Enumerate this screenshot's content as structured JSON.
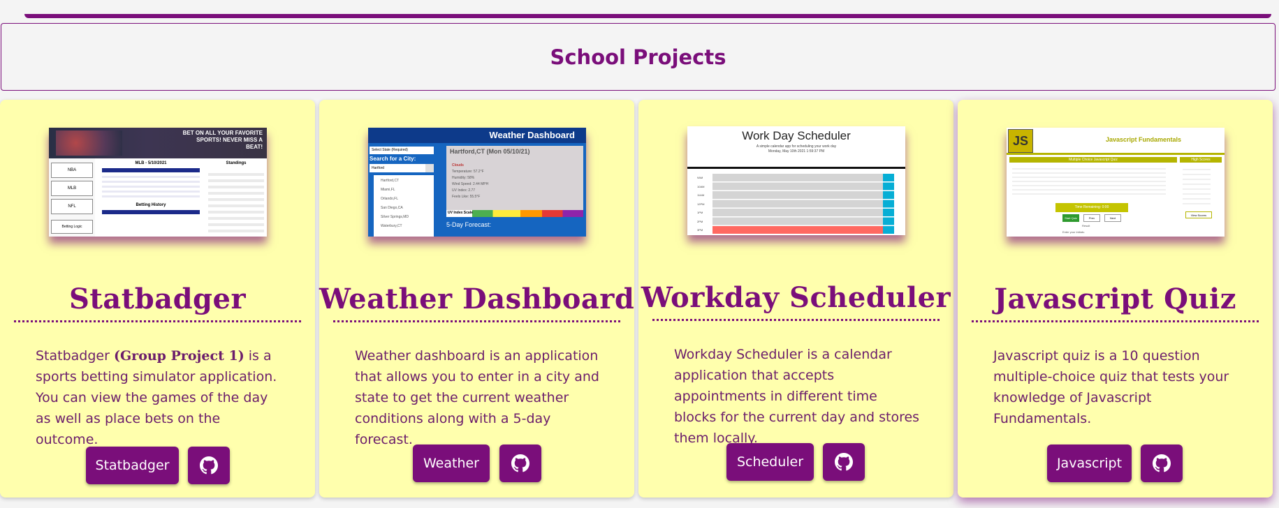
{
  "section": {
    "title": "School Projects"
  },
  "projects": [
    {
      "title": "Statbadger",
      "desc_pre": "Statbadger ",
      "desc_strong": "(Group Project 1)",
      "desc_post": " is a sports betting simulator application. You can view the games of the day as well as place bets on the outcome.",
      "app_button": "Statbadger",
      "thumb": {
        "banner": "BET ON ALL YOUR FAVORITE SPORTS! NEVER MISS A BEAT!",
        "subtitle": "MLB - 5/10/2021",
        "standings": "Standings",
        "history": "Betting History",
        "side_buttons": [
          "NBA",
          "MLB",
          "NFL",
          "Betting Logic"
        ]
      }
    },
    {
      "title": "Weather Dashboard",
      "desc": "Weather dashboard is an application that allows you to enter in a city and state to get the current weather conditions along with a 5-day forecast.",
      "app_button": "Weather",
      "thumb": {
        "header": "Weather Dashboard",
        "select": "Select State (Required)",
        "search_label": "Search for a City:",
        "search_value": "Hartford",
        "cities": [
          "Hartford,CT",
          "Miami,FL",
          "Orlando,FL",
          "San Diego,CA",
          "Silver Springs,MD",
          "Waterbury,CT"
        ],
        "city_title": "Hartford,CT (Mon 05/10/21)",
        "conditions": [
          "Clouds",
          "Temperature: 57.2°F",
          "Humidity: 58%",
          "Wind Speed: 2.44 MPH",
          "UV Index: 2.77",
          "Feels Like: 55.5°F"
        ],
        "uv_scale": "UV Index Scale",
        "forecast": "5-Day Forecast:"
      }
    },
    {
      "title": "Workday Scheduler",
      "desc": "Workday Scheduler is a calendar application that accepts appointments in different time blocks for the current day and stores them locally.",
      "app_button": "Scheduler",
      "thumb": {
        "header": "Work Day Scheduler",
        "subheader": "A simple calendar app for scheduling your work day",
        "date": "Monday, May 10th 2021 1:59:37 PM",
        "hours": [
          "9AM",
          "10AM",
          "11AM",
          "12PM",
          "1PM",
          "2PM",
          "3PM"
        ]
      }
    },
    {
      "title": "Javascript Quiz",
      "desc": "Javascript quiz is a 10 question multiple-choice quiz that tests your knowledge of Javascript Fundamentals.",
      "app_button": "Javascript",
      "thumb": {
        "logo": "JS",
        "header": "Javascript Fundamentals",
        "quiz_title": "Multiple Choice Javascript Quiz",
        "scores_title": "High Scores",
        "timer": "Time Remaining: 0:00",
        "buttons": [
          "Start Quiz",
          "Prev",
          "Next"
        ],
        "view_scores": "View Scores",
        "result": "Result",
        "initials": "Enter your initials:"
      }
    }
  ],
  "colors": {
    "accent": "#7a0e7a",
    "card": "#ffffad",
    "page": "#f4f4f4"
  },
  "icons": {
    "repo": "github-icon"
  }
}
